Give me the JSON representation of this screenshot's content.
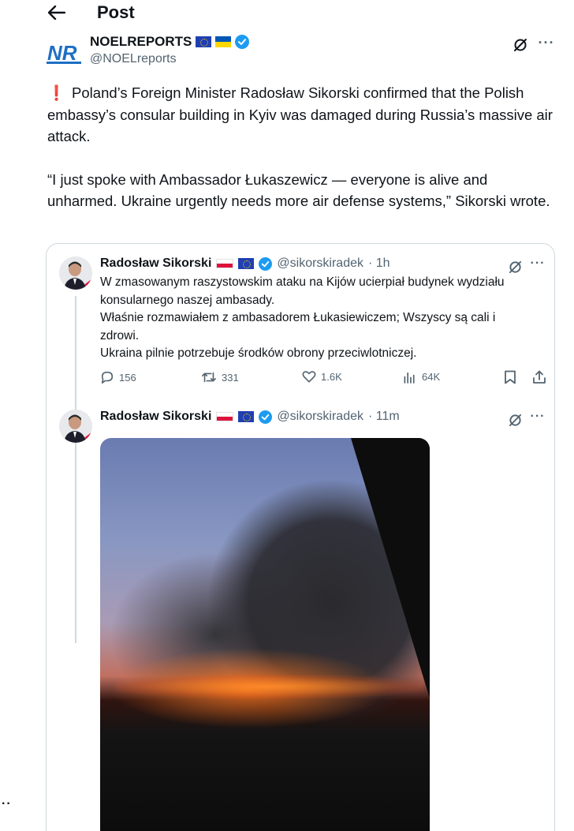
{
  "header": {
    "back_icon": "arrow-left-icon",
    "title": "Post"
  },
  "author": {
    "logo_text": "NR",
    "name": "NOELREPORTS",
    "handle": "@NOELreports",
    "badges": [
      "eu-flag",
      "ukraine-flag",
      "verified-badge"
    ]
  },
  "post": {
    "alert_icon": "❗",
    "paragraph1": "Poland’s Foreign Minister Radosław Sikorski confirmed that the Polish embassy’s consular building in Kyiv was damaged during Russia’s massive air attack.",
    "paragraph2": "“I just spoke with Ambassador Łukaszewicz — everyone is alive and unharmed. Ukraine urgently needs more air defense systems,” Sikorski wrote."
  },
  "quoted_thread": [
    {
      "name": "Radosław Sikorski",
      "handle": "@sikorskiradek",
      "time": "· 1h",
      "text_lines": [
        "W zmasowanym raszystowskim ataku na Kijów ucierpiał budynek wydziału",
        "konsularnego naszej ambasady.",
        "Właśnie rozmawiałem z ambasadorem Łukasiewiczem; Wszyscy są cali i",
        "zdrowi.",
        "Ukraina pilnie potrzebuje środków obrony przeciwlotniczej."
      ],
      "stats": {
        "replies": "156",
        "reposts": "331",
        "likes": "1.6K",
        "views": "64K"
      }
    },
    {
      "name": "Radosław Sikorski",
      "handle": "@sikorskiradek",
      "time": "· 11m"
    }
  ],
  "side_more": "··",
  "colors": {
    "text": "#0f1419",
    "secondary": "#536471",
    "verified": "#1d9bf0",
    "border": "#cfd9de",
    "alert": "#e0241b"
  }
}
